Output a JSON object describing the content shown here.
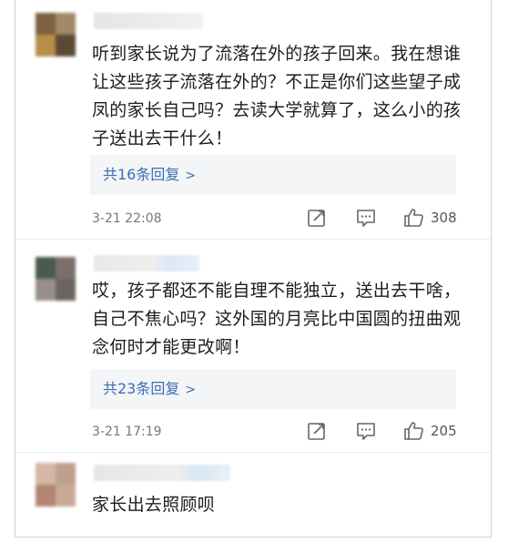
{
  "comments": [
    {
      "avatar_colors": [
        "#7c6242",
        "#a18a67",
        "#b78d48",
        "#5b4a33"
      ],
      "name_colors": [
        "#e5e5e5",
        "#eeeeee"
      ],
      "text": "听到家长说为了流落在外的孩子回来。我在想谁让这些孩子流落在外的？不正是你们这些望子成凤的家长自己吗？去读大学就算了，这么小的孩子送出去干什么！",
      "replies_label": "共16条回复",
      "time": "3-21 22:08",
      "likes": "308"
    },
    {
      "avatar_colors": [
        "#4a5a4f",
        "#7b6f6a",
        "#9a8e8d",
        "#6b6460"
      ],
      "name_colors": [
        "#e8e8e8",
        "#dbe8f7"
      ],
      "text": "哎，孩子都还不能自理不能独立，送出去干啥，自己不焦心吗？这外国的月亮比中国圆的扭曲观念何时才能更改啊！",
      "replies_label": "共23条回复",
      "time": "3-21 17:19",
      "likes": "205"
    },
    {
      "avatar_colors": [
        "#d4b7a6",
        "#bfa090",
        "#b28672",
        "#caa896"
      ],
      "name_colors": [
        "#e6e6e6",
        "#d9e6f6"
      ],
      "text": "家长出去照顾呗"
    }
  ]
}
